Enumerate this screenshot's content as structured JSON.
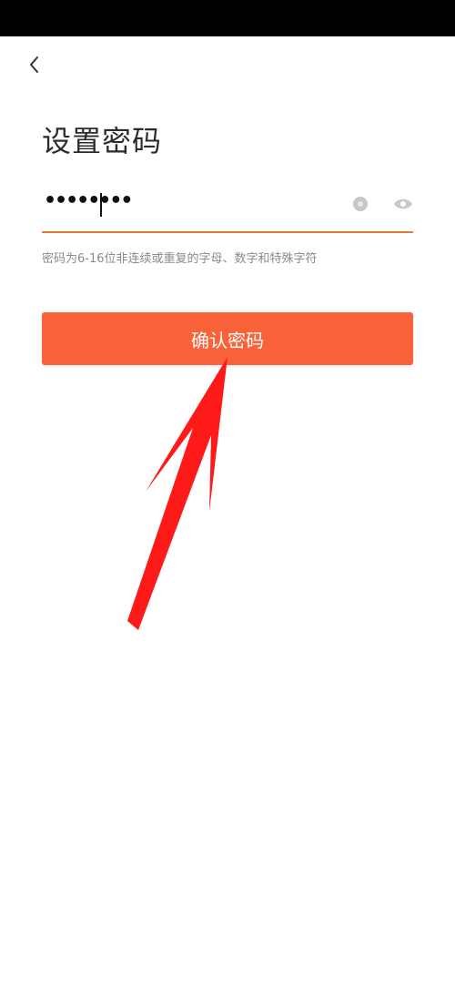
{
  "header": {
    "back_icon": "chevron-left-icon"
  },
  "page": {
    "title": "设置密码"
  },
  "password": {
    "masked_value": "••••••••",
    "clear_icon": "clear-icon",
    "visibility_icon": "eye-icon"
  },
  "hint": {
    "text": "密码为6-16位非连续或重复的字母、数字和特殊字符"
  },
  "confirm": {
    "label": "确认密码"
  },
  "annotation": {
    "arrow_color": "#ff1a1a"
  },
  "colors": {
    "accent": "#fa6339",
    "underline": "#e07a3a"
  }
}
